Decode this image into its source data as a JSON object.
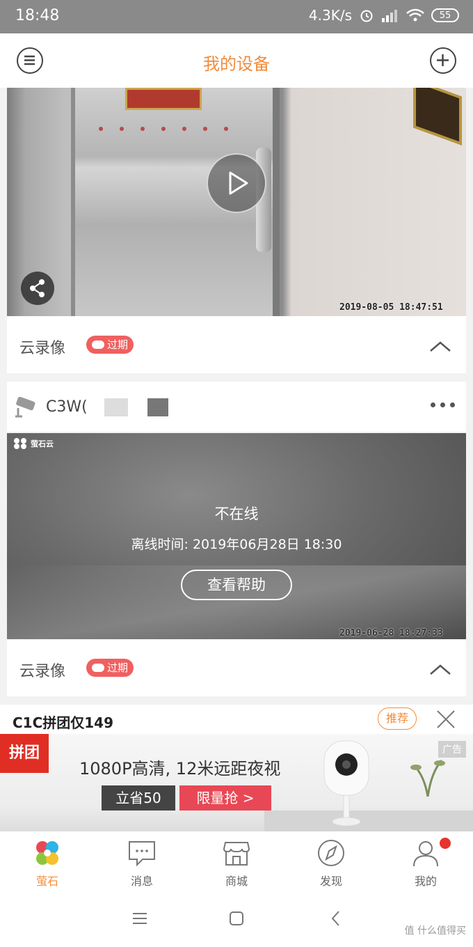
{
  "status_bar": {
    "time": "18:48",
    "speed": "4.3K/s",
    "battery": "55"
  },
  "header": {
    "title": "我的设备"
  },
  "camera1": {
    "timestamp": "2019-08-05 18:47:51",
    "cloud_label": "云录像",
    "badge": "过期"
  },
  "camera2": {
    "device_name": "C3W(",
    "brand": "萤石云",
    "status": "不在线",
    "offline_time": "离线时间: 2019年06月28日 18:30",
    "help_button": "查看帮助",
    "timestamp": "2019-06-28 18:27:33",
    "cloud_label": "云录像",
    "badge": "过期"
  },
  "ad": {
    "title": "C1C拼团仅149",
    "recommend": "推荐",
    "logo_text": "拼团",
    "headline": "1080P高清, 12米远距夜视",
    "save_tag": "立省50",
    "rush_tag": "限量抢 >",
    "ad_label": "广告"
  },
  "tabs": [
    {
      "label": "萤石",
      "icon": "ezviz-logo-icon",
      "active": true
    },
    {
      "label": "消息",
      "icon": "message-icon"
    },
    {
      "label": "商城",
      "icon": "store-icon"
    },
    {
      "label": "发现",
      "icon": "compass-icon"
    },
    {
      "label": "我的",
      "icon": "user-icon"
    }
  ],
  "watermark": "值 什么值得买",
  "colors": {
    "accent": "#f08c3c",
    "badge": "#f06060",
    "notification": "#e8322c"
  }
}
